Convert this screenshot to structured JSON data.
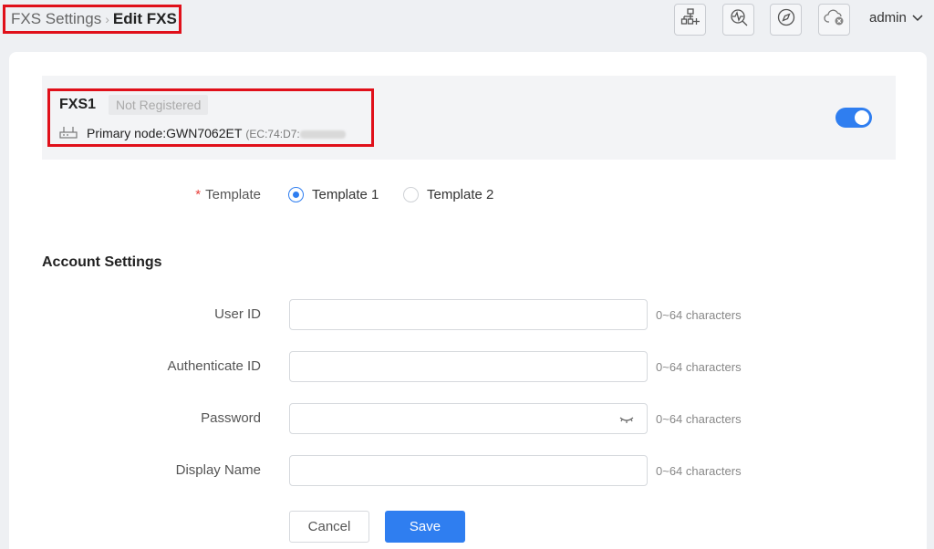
{
  "breadcrumb": {
    "parent": "FXS Settings",
    "separator": "›",
    "current": "Edit FXS"
  },
  "header": {
    "icons": [
      "add-network-icon",
      "diagnostic-search-icon",
      "compass-icon",
      "cloud-offline-icon"
    ],
    "user": "admin"
  },
  "device": {
    "name": "FXS1",
    "status": "Not Registered",
    "node_label": "Primary node:GWN7062ET",
    "mac_prefix": "(EC:74:D7:",
    "enabled": true
  },
  "template": {
    "label": "Template",
    "required_mark": "*",
    "options": [
      {
        "label": "Template 1",
        "selected": true
      },
      {
        "label": "Template 2",
        "selected": false
      }
    ]
  },
  "account": {
    "title": "Account Settings",
    "fields": [
      {
        "label": "User ID",
        "value": "",
        "hint": "0~64 characters"
      },
      {
        "label": "Authenticate ID",
        "value": "",
        "hint": "0~64 characters"
      },
      {
        "label": "Password",
        "value": "",
        "hint": "0~64 characters"
      },
      {
        "label": "Display Name",
        "value": "",
        "hint": "0~64 characters"
      }
    ]
  },
  "actions": {
    "cancel": "Cancel",
    "save": "Save"
  },
  "colors": {
    "accent": "#2f7ef0",
    "highlight_border": "#e0101a",
    "required": "#e8413c"
  }
}
